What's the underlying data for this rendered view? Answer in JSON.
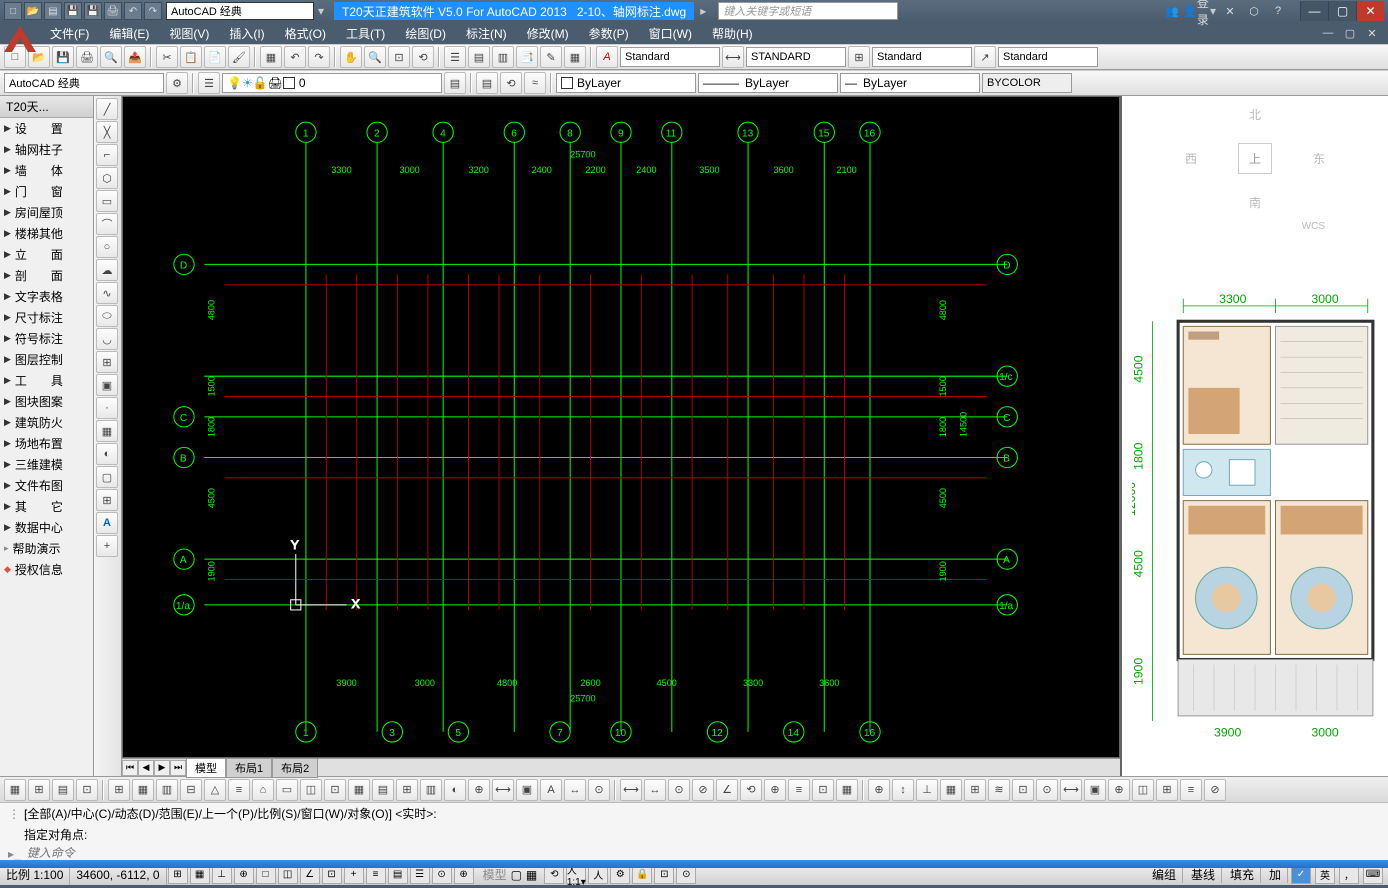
{
  "app": {
    "title_prefix": "T20天正建筑软件 V5.0 For AutoCAD 2013",
    "filename": "2-10、轴网标注.dwg",
    "workspace": "AutoCAD 经典",
    "search_placeholder": "键入关键字或短语",
    "login": "登录"
  },
  "menu": [
    "文件(F)",
    "编辑(E)",
    "视图(V)",
    "插入(I)",
    "格式(O)",
    "工具(T)",
    "绘图(D)",
    "标注(N)",
    "修改(M)",
    "参数(P)",
    "窗口(W)",
    "帮助(H)"
  ],
  "toolbar2": {
    "workspace": "AutoCAD 经典",
    "layer": "0",
    "textstyle": "Standard",
    "dimstyle": "STANDARD",
    "tablestyle": "Standard",
    "mleader": "Standard"
  },
  "props": {
    "color": "ByLayer",
    "linetype": "ByLayer",
    "lineweight": "ByLayer",
    "plotstyle": "BYCOLOR"
  },
  "t20": {
    "title": "T20天...",
    "items": [
      "设　　置",
      "轴网柱子",
      "墙　　体",
      "门　　窗",
      "房间屋顶",
      "楼梯其他",
      "立　　面",
      "剖　　面",
      "文字表格",
      "尺寸标注",
      "符号标注",
      "图层控制",
      "工　　具",
      "图块图案",
      "建筑防火",
      "场地布置",
      "三维建模",
      "文件布图",
      "其　　它",
      "数据中心",
      "帮助演示",
      "授权信息"
    ]
  },
  "grid": {
    "h_axes_top": [
      "1",
      "2",
      "4",
      "6",
      "8",
      "9",
      "11",
      "13",
      "15",
      "16"
    ],
    "h_axes_bot": [
      "1",
      "3",
      "5",
      "7",
      "10",
      "12",
      "14",
      "16"
    ],
    "v_axes": [
      "D",
      "C",
      "B",
      "A",
      "1/a"
    ],
    "top_dims": [
      "3300",
      "3000",
      "3200",
      "2400",
      "2200",
      "2400",
      "3500",
      "3600",
      "2100"
    ],
    "top_total": "25700",
    "bot_dims": [
      "3900",
      "3000",
      "4800",
      "2600",
      "4500",
      "3300",
      "3600"
    ],
    "bot_total": "25700",
    "left_dims": [
      "4800",
      "1500",
      "1800",
      "4500",
      "1900"
    ],
    "left_mid": [
      "1/c",
      "14500"
    ],
    "right_dims": [
      "4800",
      "1500",
      "1800",
      "4500",
      "1900"
    ],
    "right_total": "14500"
  },
  "layout_tabs": {
    "model": "模型",
    "layout1": "布局1",
    "layout2": "布局2"
  },
  "command": {
    "history": "[全部(A)/中心(C)/动态(D)/范围(E)/上一个(P)/比例(S)/窗口(W)/对象(O)] <实时>:",
    "prompt": "指定对角点:",
    "input_placeholder": "键入命令"
  },
  "status": {
    "scale_label": "比例 1:100",
    "coords": "34600, -6112, 0",
    "modes": [
      "编组",
      "基线",
      "填充",
      "加"
    ],
    "ime": "英"
  },
  "compass": {
    "n": "北",
    "s": "南",
    "e": "东",
    "w": "西",
    "up": "上",
    "wcs": "WCS"
  },
  "floorplan_dims": {
    "top1": "3300",
    "top2": "3000",
    "left1": "4500",
    "left2": "1800",
    "left_total": "12600",
    "bot1": "3900",
    "bot2": "3000",
    "left3": "4500",
    "left4": "1900"
  }
}
